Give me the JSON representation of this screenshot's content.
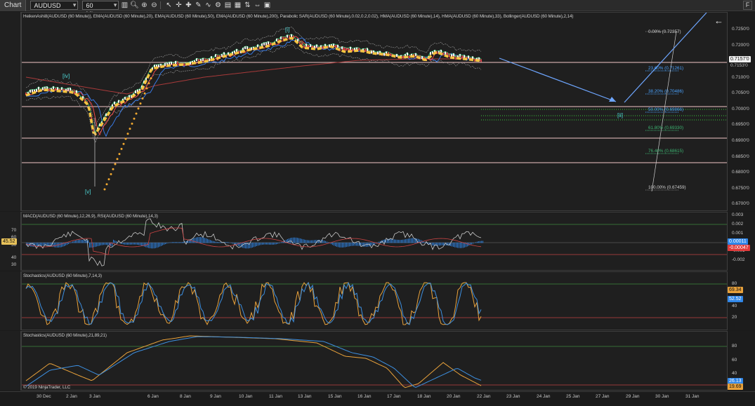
{
  "toolbar": {
    "chart_tab": "Chart",
    "instrument": "AUDUSD",
    "interval": "60 Minute",
    "icons": [
      "chart-style-icon",
      "search-icon",
      "zoom-in-icon",
      "zoom-out-icon",
      "pointer-icon",
      "crosshair-icon",
      "global-crosshair-icon",
      "draw-icon",
      "indicators-icon",
      "properties-icon",
      "templates-icon",
      "objects-icon",
      "trade-icon",
      "scroll-icon",
      "chart-trader-icon"
    ],
    "f_button": "F"
  },
  "price_panel": {
    "indicators_label": "HeikenAshi8(AUDUSD (60 Minute)), EMA(AUDUSD (60 Minute),20), EMA(AUDUSD (60 Minute),50), EMA(AUDUSD (60 Minute),200), Parabolic SAR(AUDUSD (60 Minute),0.02,0.2,0.02), HMA(AUDUSD (60 Minute),14), HMA(AUDUSD (60 Minute),33), Bollinger(AUDUSD (60 Minute),2,14)",
    "axis_ticks": [
      "0.7250'0",
      "0.7200'0",
      "0.7150'0",
      "0.7100'0",
      "0.7050'0",
      "0.7000'0",
      "0.6950'0",
      "0.6900'0",
      "0.6850'0",
      "0.6800'0",
      "0.6750'0",
      "0.6700'0"
    ],
    "last_price": "0.7157'0",
    "last_price_2": "0.7153'0",
    "fib_levels": [
      {
        "label": "0.00% (0.72357)",
        "color": "#d0d0d0"
      },
      {
        "label": "23.60% (0.71261)",
        "color": "#4aa3ff"
      },
      {
        "label": "38.20% (0.70486)",
        "color": "#4aa3ff"
      },
      {
        "label": "50.00% (0.69866)",
        "color": "#4aa3ff"
      },
      {
        "label": "61.80% (0.69330)",
        "color": "#3cb371"
      },
      {
        "label": "76.40% (0.68615)",
        "color": "#3cb371"
      },
      {
        "label": "100.00% (0.67459)",
        "color": "#d0d0d0"
      }
    ],
    "waves": [
      "[iv]",
      "[v]",
      "[i]",
      "[ii]"
    ],
    "back_arrow": "←"
  },
  "macd_panel": {
    "label": "MACD(AUDUSD (60 Minute),12,26,9), RSI(AUDUSD (60 Minute),14,3)",
    "left_ticks": [
      "70",
      "60",
      "50",
      "40",
      "30"
    ],
    "left_badge": "45.52",
    "right_ticks": [
      "0.003",
      "0.002",
      "0.001",
      "0",
      "-0.001",
      "-0.002"
    ],
    "badge_a": "0.00011",
    "badge_b": "-0.00047"
  },
  "stoch1_panel": {
    "label": "Stochastics(AUDUSD (60 Minute),7,14,3)",
    "right_ticks": [
      "80",
      "60",
      "40",
      "20"
    ],
    "badge_a": "69.34",
    "badge_b": "52.52"
  },
  "stoch2_panel": {
    "label": "Stochastics(AUDUSD (60 Minute),21,89,21)",
    "copyright": "© 2019 NinjaTrader, LLC",
    "right_ticks": [
      "80",
      "60",
      "40",
      "20"
    ],
    "badge_a": "26.13",
    "badge_b": "19.69"
  },
  "x_axis": [
    "30 Dec",
    "2 Jan",
    "3 Jan",
    "6 Jan",
    "8 Jan",
    "9 Jan",
    "10 Jan",
    "11 Jan",
    "13 Jan",
    "15 Jan",
    "16 Jan",
    "17 Jan",
    "18 Jan",
    "20 Jan",
    "22 Jan",
    "23 Jan",
    "24 Jan",
    "25 Jan",
    "27 Jan",
    "29 Jan",
    "30 Jan",
    "31 Jan"
  ],
  "colors": {
    "heiken": "#e0e0e0",
    "ema20": "#ff4b4b",
    "ema50": "#3b82f6",
    "ema200": "#a83a3a",
    "psar": "#f0a830",
    "hma14": "#2ecc71",
    "hma33": "#f5c542",
    "bollinger": "#9a9a9a",
    "fib_blue": "#4aa3ff",
    "fib_green": "#3cb371",
    "level_line": "#f2c4c4",
    "stoch_k": "#e9a23b",
    "stoch_d": "#3d8fe0",
    "macd_hist": "#2f86e8",
    "badge_orange": "#e9a23b",
    "badge_blue": "#2f86e8",
    "badge_red": "#e03a3a"
  }
}
